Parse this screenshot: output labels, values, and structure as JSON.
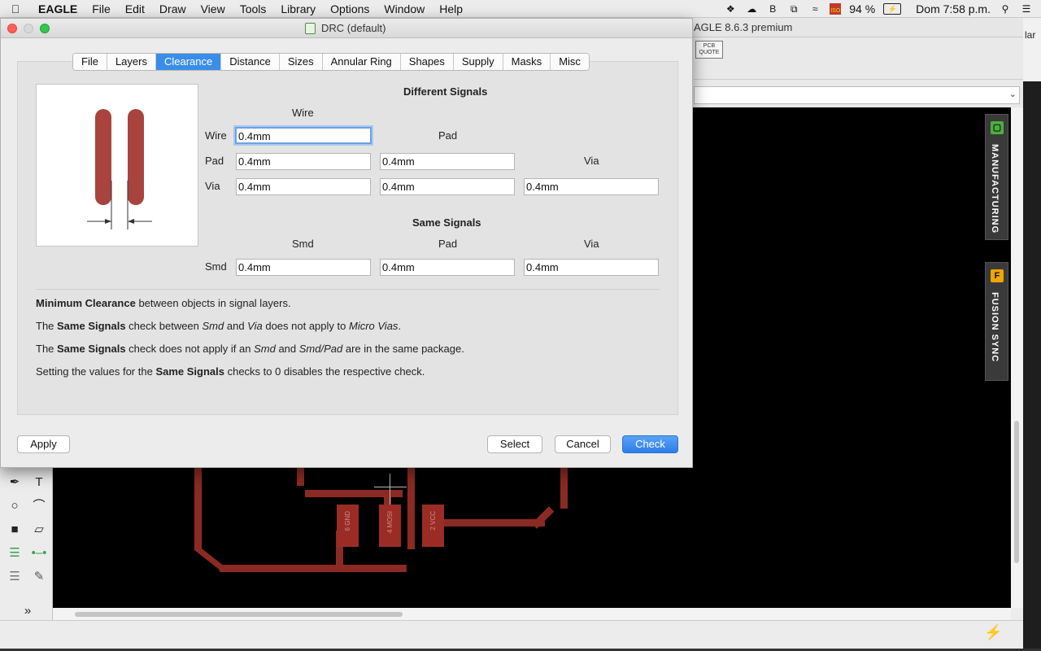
{
  "menubar": {
    "app_name": "EAGLE",
    "items": [
      "File",
      "Edit",
      "Draw",
      "View",
      "Tools",
      "Library",
      "Options",
      "Window",
      "Help"
    ],
    "battery": "94 %",
    "clock": "Dom 7:58 p.m.",
    "flag_label": "ISO"
  },
  "main_window": {
    "title": "AGLE 8.6.3 premium",
    "pcb_quote": "PCB QUOTE",
    "right_edge_text": "lar",
    "side_tabs": {
      "manufacturing": "MANUFACTURING",
      "fusion_sync": "FUSION SYNC"
    },
    "parts": [
      {
        "pin": "6",
        "name": "GND"
      },
      {
        "pin": "4",
        "name": "MOSI"
      },
      {
        "pin": "2",
        "name": "VCC"
      }
    ]
  },
  "dialog": {
    "title": "DRC (default)",
    "tabs": [
      {
        "label": "File",
        "active": false
      },
      {
        "label": "Layers",
        "active": false
      },
      {
        "label": "Clearance",
        "active": true
      },
      {
        "label": "Distance",
        "active": false
      },
      {
        "label": "Sizes",
        "active": false
      },
      {
        "label": "Annular Ring",
        "active": false
      },
      {
        "label": "Shapes",
        "active": false
      },
      {
        "label": "Supply",
        "active": false
      },
      {
        "label": "Masks",
        "active": false
      },
      {
        "label": "Misc",
        "active": false
      }
    ],
    "different_signals": {
      "heading": "Different Signals",
      "col_wire": "Wire",
      "col_pad": "Pad",
      "col_via": "Via",
      "row_wire": "Wire",
      "row_pad": "Pad",
      "row_via": "Via",
      "wire_wire": "0.4mm",
      "pad_wire": "0.4mm",
      "pad_pad": "0.4mm",
      "via_wire": "0.4mm",
      "via_pad": "0.4mm",
      "via_via": "0.4mm"
    },
    "same_signals": {
      "heading": "Same Signals",
      "col_smd": "Smd",
      "col_pad": "Pad",
      "col_via": "Via",
      "row_smd": "Smd",
      "smd_smd": "0.4mm",
      "smd_pad": "0.4mm",
      "smd_via": "0.4mm"
    },
    "notes": {
      "n1_bold": "Minimum Clearance",
      "n1_rest": " between objects in signal layers.",
      "n2_a": "The ",
      "n2_bold": "Same Signals",
      "n2_b": " check between ",
      "n2_i1": "Smd",
      "n2_c": " and ",
      "n2_i2": "Via",
      "n2_d": " does not apply to ",
      "n2_i3": "Micro Vias",
      "n2_e": ".",
      "n3_a": "The ",
      "n3_bold": "Same Signals",
      "n3_b": " check does not apply if an ",
      "n3_i1": "Smd",
      "n3_c": " and ",
      "n3_i2": "Smd/Pad",
      "n3_d": " are in the same package.",
      "n4_a": "Setting the values for the ",
      "n4_bold": "Same Signals",
      "n4_b": " checks to 0 disables the respective check."
    },
    "buttons": {
      "apply": "Apply",
      "select": "Select",
      "cancel": "Cancel",
      "check": "Check"
    }
  }
}
